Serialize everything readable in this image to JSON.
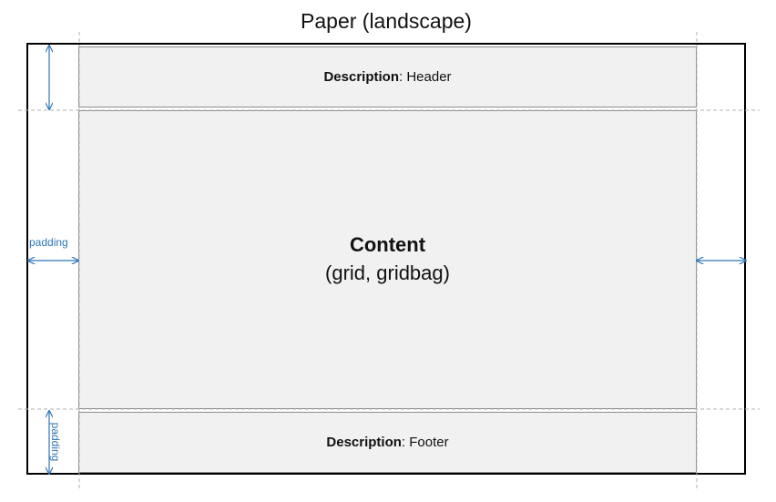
{
  "title": "Paper (landscape)",
  "header": {
    "label": "Description",
    "separator": ":",
    "value": "Header"
  },
  "content": {
    "title": "Content",
    "subtitle": "(grid, gridbag)"
  },
  "footer": {
    "label": "Description",
    "separator": ":",
    "value": "Footer"
  },
  "padding_labels": {
    "left": "padding",
    "bottom": "padding"
  },
  "colors": {
    "arrow": "#2e75b6",
    "box_fill": "#f1f1f1",
    "box_border": "#8c8c8c",
    "guide": "#b0b0b0",
    "paper_border": "#000000"
  }
}
